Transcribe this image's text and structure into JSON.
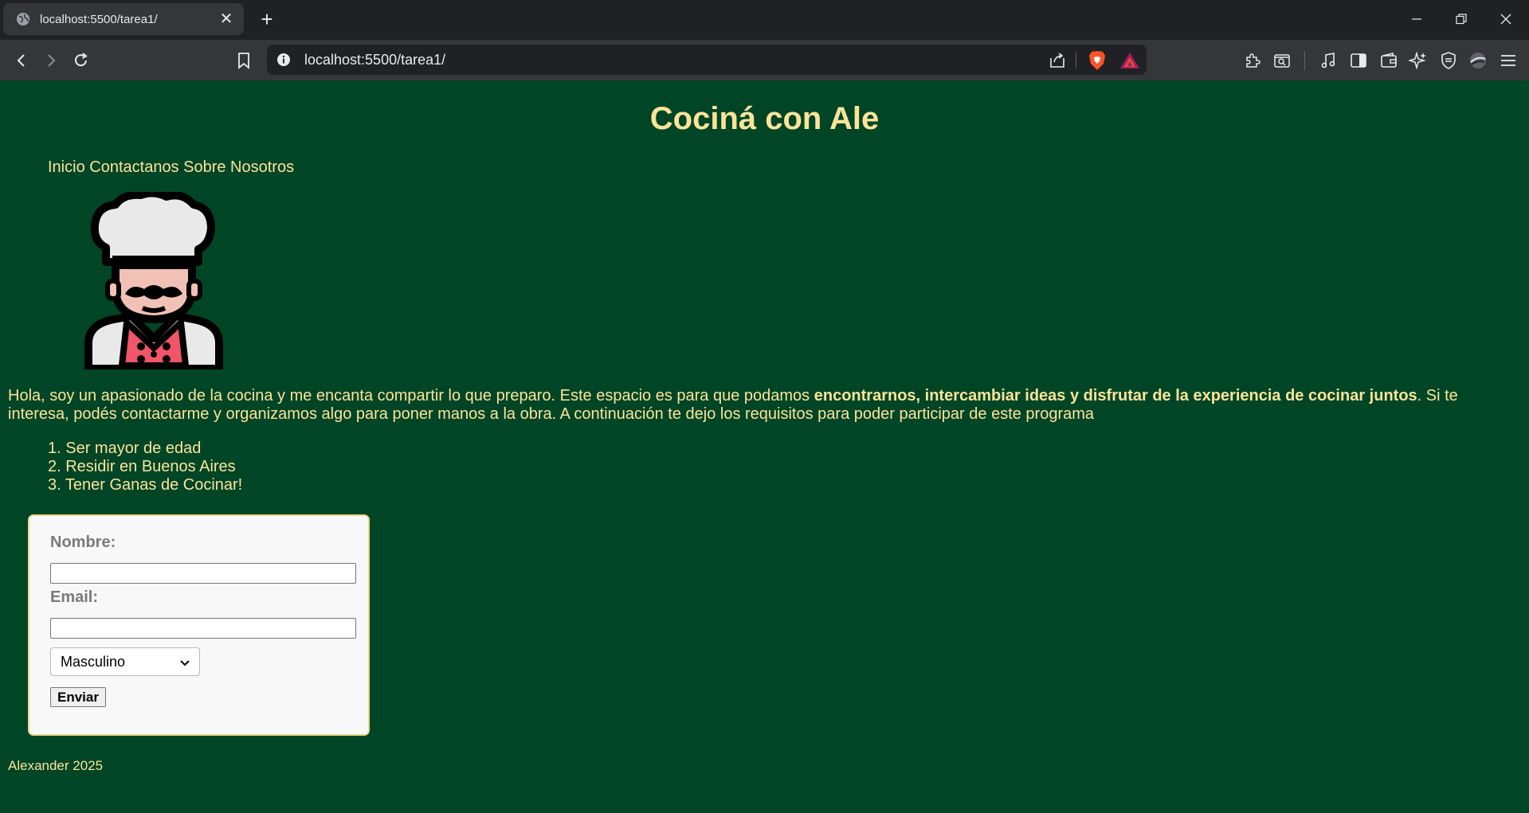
{
  "browser": {
    "tab_title": "localhost:5500/tarea1/",
    "url": "localhost:5500/tarea1/"
  },
  "site": {
    "title": "Cociná con Ale",
    "nav": [
      "Inicio",
      "Contactanos",
      "Sobre Nosotros"
    ],
    "intro_before": "Hola, soy un apasionado de la cocina y me encanta compartir lo que preparo. Este espacio es para que podamos ",
    "intro_bold": "encontrarnos, intercambiar ideas y disfrutar de la experiencia de cocinar juntos",
    "intro_after": ". Si te interesa, podés contactarme y organizamos algo para poner manos a la obra. A continuación te dejo los requisitos para poder participar de este programa",
    "requirements": [
      "1. Ser mayor de edad",
      "2. Residir en Buenos Aires",
      "3. Tener Ganas de Cocinar!"
    ],
    "form": {
      "name_label": "Nombre:",
      "email_label": "Email:",
      "gender_selected": "Masculino",
      "submit_label": "Enviar"
    },
    "footer": "Alexander 2025"
  },
  "colors": {
    "page_bg": "#004526",
    "text_accent": "#fbe49a"
  }
}
